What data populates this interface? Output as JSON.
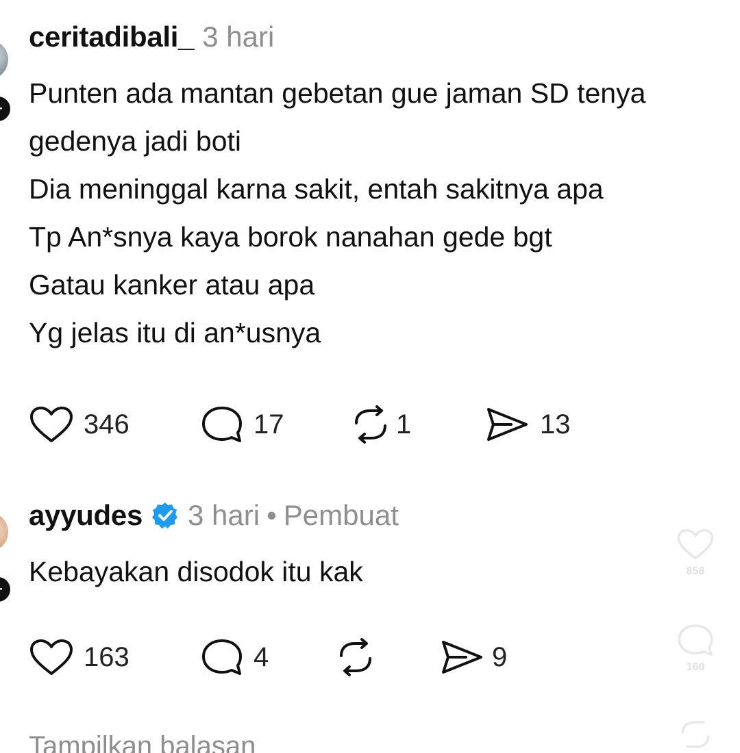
{
  "comments": [
    {
      "username": "ceritadibali_",
      "time": "3 hari",
      "body_lines": [
        "Punten ada mantan gebetan gue jaman SD tenya",
        "gedenya jadi boti",
        "Dia meninggal karna sakit, entah sakitnya apa",
        "Tp An*snya kaya borok nanahan gede bgt",
        "Gatau kanker atau apa",
        "Yg jelas itu di an*usnya"
      ],
      "likes": "346",
      "replies": "17",
      "reposts": "1",
      "shares": "13"
    },
    {
      "username": "ayyudes",
      "verified": true,
      "time": "3 hari",
      "separator": "•",
      "role": "Pembuat",
      "body_lines": [
        "Kebayakan disodok itu kak"
      ],
      "likes": "163",
      "replies": "4",
      "reposts": "",
      "shares": "9"
    }
  ],
  "footer": {
    "show_replies": "Tampilkan balasan"
  },
  "side_rail": {
    "like_count": "858",
    "comment_count": "160"
  },
  "colors": {
    "text": "#111111",
    "muted": "#8e8e8e",
    "verified": "#1d9bf0"
  },
  "icons": [
    "heart-icon",
    "comment-icon",
    "repost-icon",
    "share-icon",
    "verified-icon",
    "plus-icon"
  ]
}
